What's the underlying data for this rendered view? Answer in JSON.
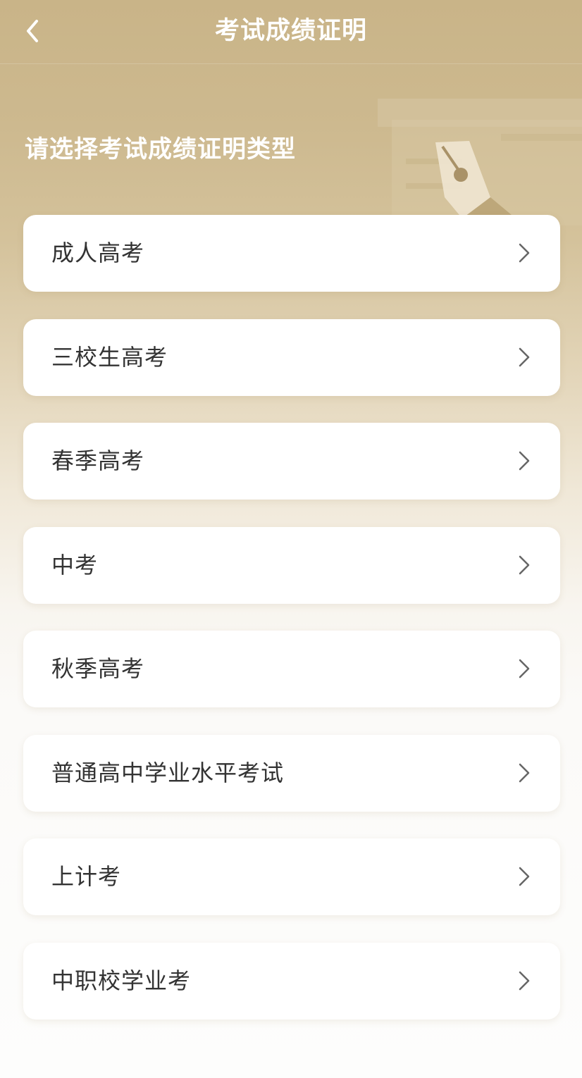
{
  "header": {
    "back_icon": "chevron-left-icon",
    "title": "考试成绩证明"
  },
  "prompt": "请选择考试成绩证明类型",
  "decoration_icon": "fountain-pen-icon",
  "exam_types": [
    {
      "label": "成人高考"
    },
    {
      "label": "三校生高考"
    },
    {
      "label": "春季高考"
    },
    {
      "label": "中考"
    },
    {
      "label": "秋季高考"
    },
    {
      "label": "普通高中学业水平考试"
    },
    {
      "label": "上计考"
    },
    {
      "label": "中职校学业考"
    }
  ],
  "item_icon": "chevron-right-icon",
  "colors": {
    "header_bg": "#c9b488",
    "card_bg": "#ffffff",
    "text": "#333333",
    "chevron": "#666666"
  }
}
